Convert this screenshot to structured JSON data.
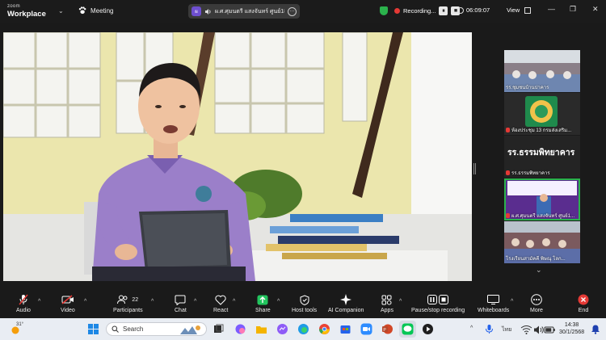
{
  "titlebar": {
    "brand_small": "zoom",
    "brand_big": "Workplace",
    "meeting_label": "Meeting",
    "speaker_name": "ผ.ศ.ศุมนตรี แสงจันทร์ ศูนย์18's",
    "recording_label": "Recording...",
    "timer": "06:09:07",
    "view_label": "View"
  },
  "side_tiles": [
    {
      "label": "รร.ชุมชนบ้านปาคาร"
    },
    {
      "label": "ห้องประชุม 13 กรมส่งเสริม..."
    },
    {
      "label": "รร.ธรรมพิทยาคาร",
      "banner": "รร.ธรรมพิทยาคาร"
    },
    {
      "label": "ผ.ศ.ศุมนตรี แสงจันทร์ ศูนย์1..."
    },
    {
      "label": "โรงเรียนสามัคคี พิษณุ โลก..."
    }
  ],
  "toolbar": {
    "audio": "Audio",
    "video": "Video",
    "participants": "Participants",
    "participants_count": "22",
    "chat": "Chat",
    "react": "React",
    "share": "Share",
    "host_tools": "Host tools",
    "ai_companion": "AI Companion",
    "apps": "Apps",
    "pause_recording": "Pause/stop recording",
    "whiteboards": "Whiteboards",
    "more": "More",
    "end": "End"
  },
  "taskbar": {
    "temperature": "31°",
    "search_placeholder": "Search",
    "language": "ไทย",
    "time": "14:38",
    "date": "30/1/2568"
  },
  "colors": {
    "accent_green": "#2bb24c",
    "record_red": "#e53935",
    "share_green": "#22c55e"
  }
}
